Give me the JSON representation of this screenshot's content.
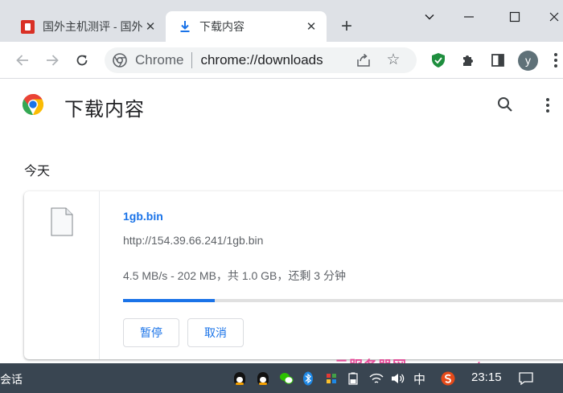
{
  "tabs": {
    "inactive_title": "国外主机测评 - 国外",
    "active_title": "下载内容"
  },
  "toolbar": {
    "omnibox_label": "Chrome",
    "omnibox_url": "chrome://downloads",
    "avatar_letter": "y"
  },
  "page": {
    "title": "下载内容",
    "date_heading": "今天"
  },
  "download": {
    "file_name": "1gb.bin",
    "url": "http://154.39.66.241/1gb.bin",
    "status": "4.5 MB/s - 202 MB，共 1.0 GB，还剩 3 分钟",
    "progress_fraction": 0.197,
    "pause_label": "暂停",
    "cancel_label": "取消"
  },
  "taskbar": {
    "left_text": "会话",
    "ime_label": "中",
    "clock": "23:15"
  },
  "watermark": {
    "text": "云服务器网 www.yuntue.com"
  },
  "colors": {
    "accent": "#1a73e8",
    "tabstrip": "#dee1e6",
    "taskbar": "#394551",
    "shield_green": "#1e8e3e"
  }
}
